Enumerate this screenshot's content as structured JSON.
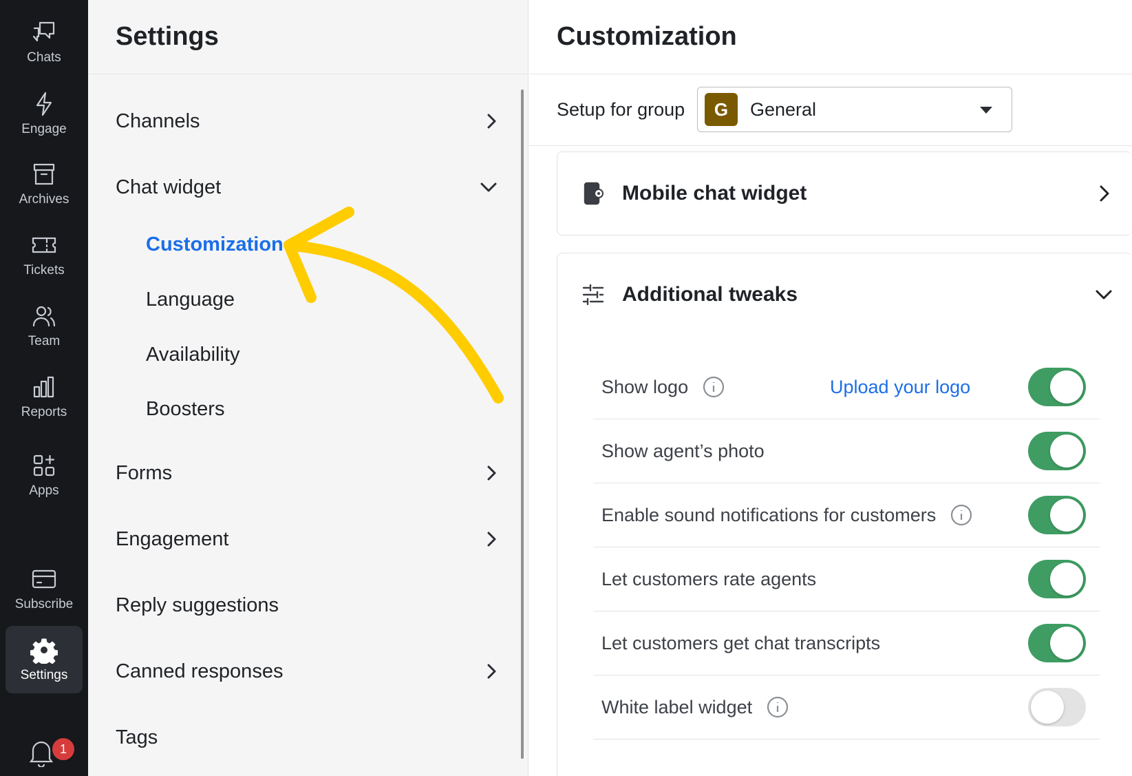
{
  "rail": {
    "items": [
      {
        "label": "Chats",
        "icon": "chats-icon"
      },
      {
        "label": "Engage",
        "icon": "bolt-icon"
      },
      {
        "label": "Archives",
        "icon": "archive-icon"
      },
      {
        "label": "Tickets",
        "icon": "ticket-icon"
      },
      {
        "label": "Team",
        "icon": "team-icon"
      },
      {
        "label": "Reports",
        "icon": "bar-chart-icon"
      },
      {
        "label": "Apps",
        "icon": "apps-grid-icon"
      },
      {
        "label": "Subscribe",
        "icon": "credit-card-icon"
      },
      {
        "label": "Settings",
        "icon": "gear-icon",
        "active": true
      }
    ],
    "notifications_count": "1"
  },
  "settings": {
    "title": "Settings",
    "nav": [
      {
        "label": "Channels",
        "chevron": "right"
      },
      {
        "label": "Chat widget",
        "chevron": "down"
      },
      {
        "label": "Forms",
        "chevron": "right"
      },
      {
        "label": "Engagement",
        "chevron": "right"
      },
      {
        "label": "Reply suggestions",
        "chevron": "none"
      },
      {
        "label": "Canned responses",
        "chevron": "right"
      },
      {
        "label": "Tags",
        "chevron": "none"
      }
    ],
    "chat_widget_sub": [
      {
        "label": "Customization",
        "active": true
      },
      {
        "label": "Language"
      },
      {
        "label": "Availability"
      },
      {
        "label": "Boosters"
      }
    ]
  },
  "main": {
    "title": "Customization",
    "group_label": "Setup for group",
    "group": {
      "initial": "G",
      "name": "General",
      "color": "#7a5a00"
    },
    "mobile_card_title": "Mobile chat widget",
    "tweaks_card_title": "Additional tweaks",
    "upload_logo_link": "Upload your logo",
    "tweaks": [
      {
        "label": "Show logo",
        "info": true,
        "on": true
      },
      {
        "label": "Show agent’s photo",
        "info": false,
        "on": true
      },
      {
        "label": "Enable sound notifications for customers",
        "info": true,
        "on": true
      },
      {
        "label": "Let customers rate agents",
        "info": false,
        "on": true
      },
      {
        "label": "Let customers get chat transcripts",
        "info": false,
        "on": true
      },
      {
        "label": "White label widget",
        "info": true,
        "on": false
      }
    ]
  },
  "colors": {
    "accent": "#1b6ee8",
    "toggle_on": "#3f9d63",
    "annotation_arrow": "#ffcc00",
    "rail_bg": "#16181c"
  }
}
